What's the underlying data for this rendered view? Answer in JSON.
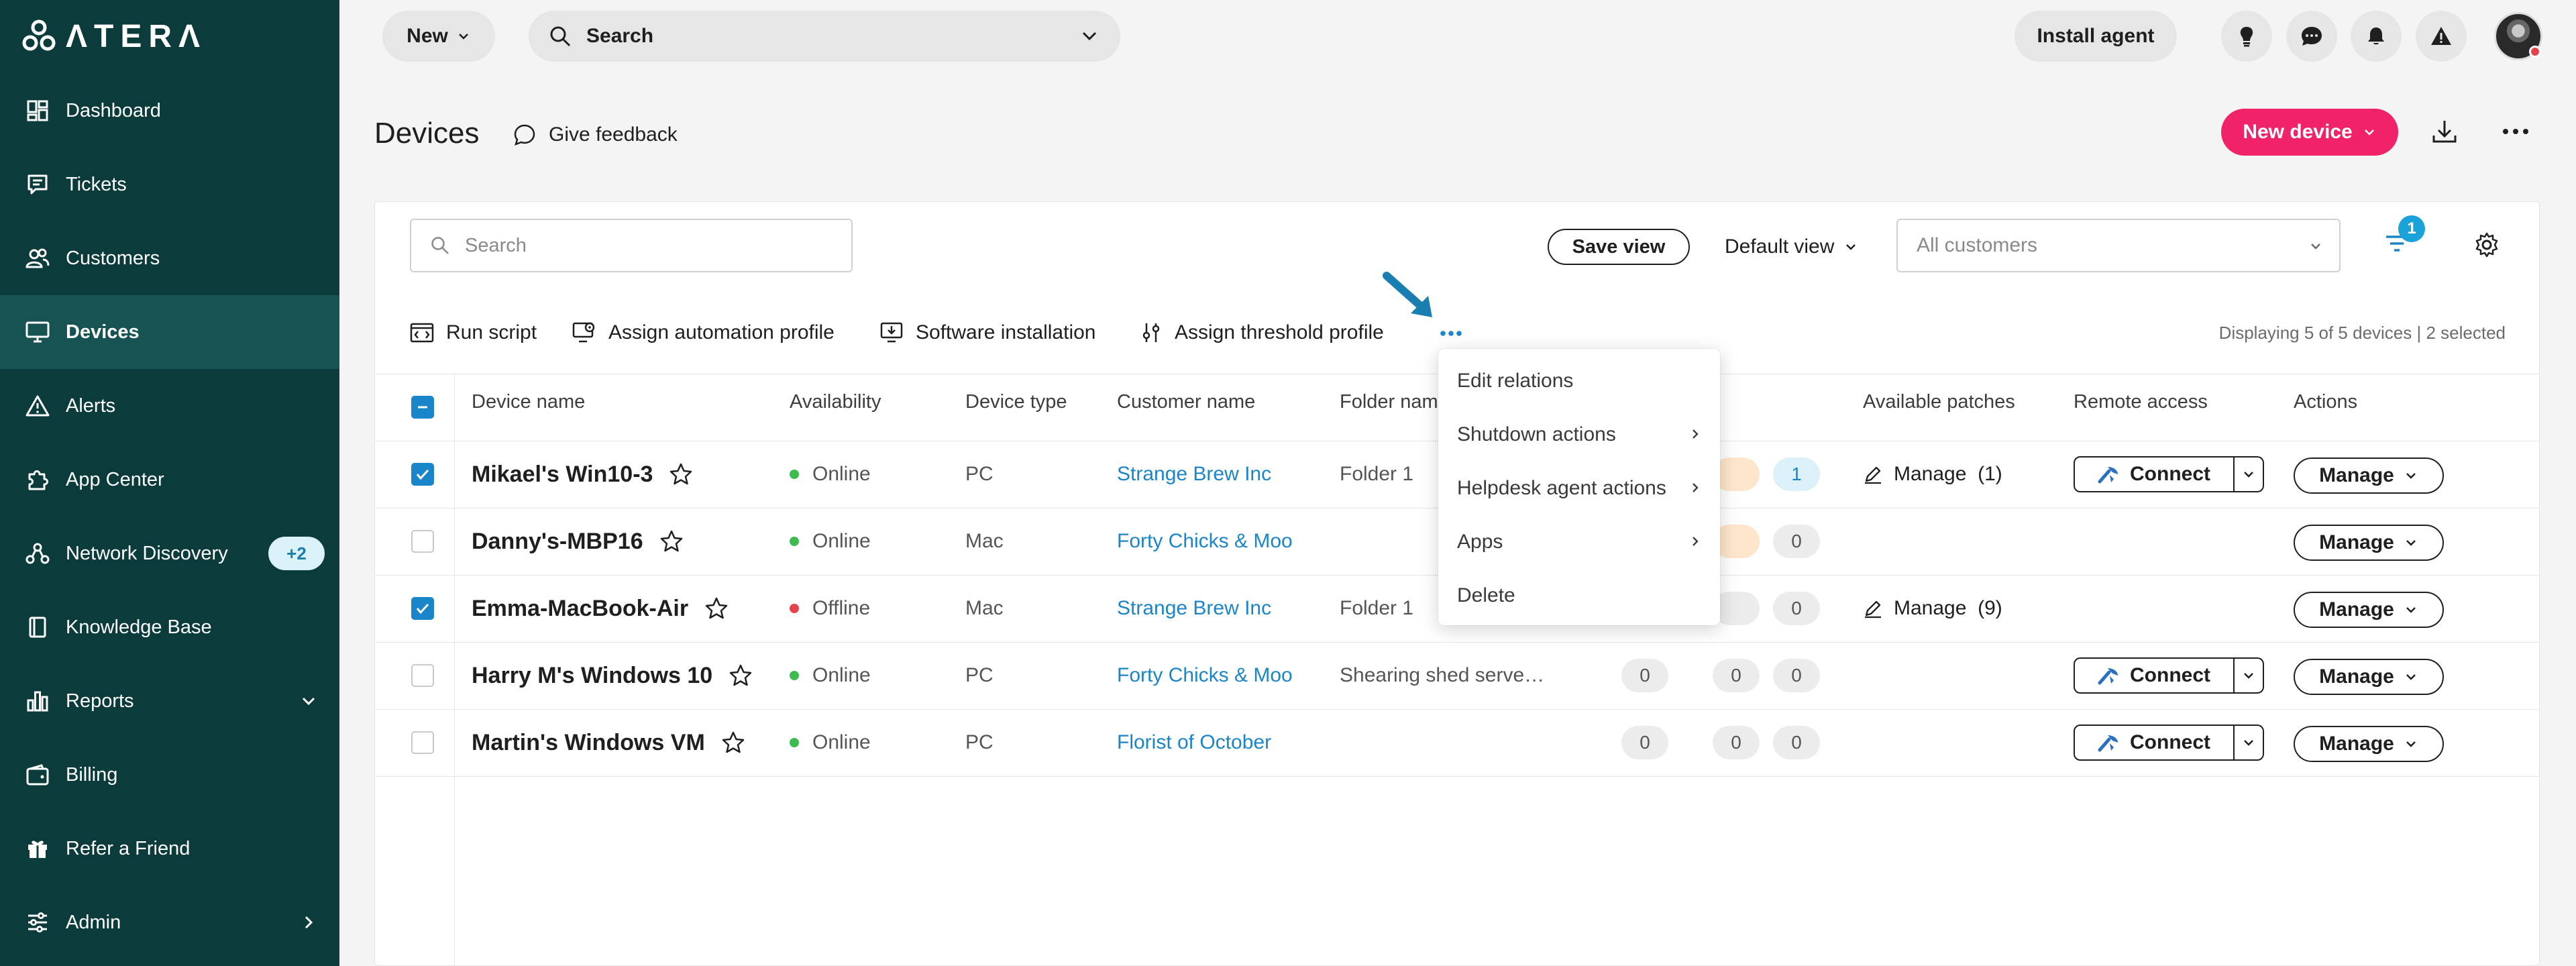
{
  "app": {
    "logo_text": "ΛTERΛ"
  },
  "sidebar": {
    "items": [
      {
        "label": "Dashboard"
      },
      {
        "label": "Tickets"
      },
      {
        "label": "Customers"
      },
      {
        "label": "Devices"
      },
      {
        "label": "Alerts"
      },
      {
        "label": "App Center"
      },
      {
        "label": "Network Discovery",
        "badge": "+2"
      },
      {
        "label": "Knowledge Base"
      },
      {
        "label": "Reports"
      },
      {
        "label": "Billing"
      },
      {
        "label": "Refer a Friend"
      },
      {
        "label": "Admin"
      }
    ],
    "active": "Devices"
  },
  "topbar": {
    "new_label": "New",
    "search_label": "Search",
    "install_label": "Install agent"
  },
  "page": {
    "title": "Devices",
    "feedback_label": "Give feedback",
    "new_device_label": "New device"
  },
  "panel": {
    "search_placeholder": "Search",
    "save_view_label": "Save view",
    "default_view_label": "Default view",
    "customers_placeholder": "All customers",
    "filter_badge": "1",
    "toolbar": {
      "run_script": "Run script",
      "assign_automation": "Assign automation profile",
      "software_install": "Software installation",
      "assign_threshold": "Assign threshold profile"
    },
    "display_count": "Displaying 5 of 5 devices | 2 selected"
  },
  "table": {
    "headers": {
      "device_name": "Device name",
      "availability": "Availability",
      "device_type": "Device type",
      "customer_name": "Customer name",
      "folder_name": "Folder nam",
      "available_patches": "Available patches",
      "remote_access": "Remote access",
      "actions": "Actions"
    },
    "connect_label": "Connect",
    "manage_label": "Manage",
    "rows": [
      {
        "name": "Mikael's Win10-3",
        "availability": "Online",
        "type": "PC",
        "customer": "Strange Brew Inc",
        "folder": "Folder 1",
        "c1": "",
        "c2": "",
        "c3": "1",
        "patches": "Manage  (1)"
      },
      {
        "name": "Danny's-MBP16",
        "availability": "Online",
        "type": "Mac",
        "customer": "Forty Chicks & Moo",
        "folder": "",
        "c1": "",
        "c2": "",
        "c3": "0",
        "patches": ""
      },
      {
        "name": "Emma-MacBook-Air",
        "availability": "Offline",
        "type": "Mac",
        "customer": "Strange Brew Inc",
        "folder": "Folder 1",
        "c1": "",
        "c2": "",
        "c3": "0",
        "patches": "Manage  (9)"
      },
      {
        "name": "Harry M's Windows 10",
        "availability": "Online",
        "type": "PC",
        "customer": "Forty Chicks & Moo",
        "folder": "Shearing shed serve…",
        "c1": "0",
        "c2": "0",
        "c3": "0",
        "patches": ""
      },
      {
        "name": "Martin's Windows VM",
        "availability": "Online",
        "type": "PC",
        "customer": "Florist of October",
        "folder": "",
        "c1": "0",
        "c2": "0",
        "c3": "0",
        "patches": ""
      }
    ]
  },
  "context_menu": {
    "items": [
      {
        "label": "Edit relations"
      },
      {
        "label": "Shutdown actions"
      },
      {
        "label": "Helpdesk agent actions"
      },
      {
        "label": "Apps"
      },
      {
        "label": "Delete"
      }
    ]
  },
  "colors": {
    "sidebar_bg": "#0b3b3b",
    "sidebar_active": "#175353",
    "accent_pink": "#f0236a",
    "link_blue": "#1a86c9",
    "online_green": "#3dbb4e",
    "offline_red": "#e7434b"
  }
}
